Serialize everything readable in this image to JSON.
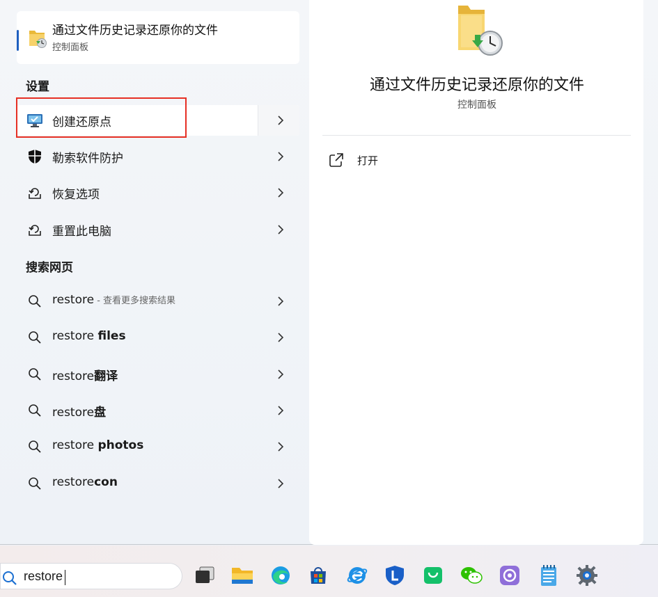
{
  "best_match": {
    "title": "通过文件历史记录还原你的文件",
    "subtitle": "控制面板"
  },
  "settings_section": {
    "header": "设置",
    "items": [
      {
        "label": "创建还原点",
        "icon": "system-restore-monitor-icon"
      },
      {
        "label": "勒索软件防护",
        "icon": "shield-icon"
      },
      {
        "label": "恢复选项",
        "icon": "recovery-icon"
      },
      {
        "label": "重置此电脑",
        "icon": "reset-pc-icon"
      }
    ]
  },
  "web_section": {
    "header": "搜索网页",
    "items": [
      {
        "prefix": "restore",
        "bold": "",
        "hint": " - 查看更多搜索结果"
      },
      {
        "prefix": "restore ",
        "bold": "files",
        "hint": ""
      },
      {
        "prefix": "restore",
        "bold": "翻译",
        "hint": ""
      },
      {
        "prefix": "restore",
        "bold": "盘",
        "hint": ""
      },
      {
        "prefix": "restore ",
        "bold": "photos",
        "hint": ""
      },
      {
        "prefix": "restore",
        "bold": "con",
        "hint": ""
      }
    ]
  },
  "preview": {
    "title": "通过文件历史记录还原你的文件",
    "subtitle": "控制面板",
    "open_label": "打开"
  },
  "taskbar": {
    "search_value": "restore",
    "apps": [
      {
        "name": "task-view-icon"
      },
      {
        "name": "file-explorer-icon"
      },
      {
        "name": "edge-icon"
      },
      {
        "name": "microsoft-store-icon"
      },
      {
        "name": "ie-browser-icon"
      },
      {
        "name": "lenovo-app-icon"
      },
      {
        "name": "shopping-bag-app-icon"
      },
      {
        "name": "wechat-icon"
      },
      {
        "name": "camera-app-icon"
      },
      {
        "name": "notepad-icon"
      },
      {
        "name": "settings-gear-icon"
      }
    ]
  },
  "colors": {
    "accent": "#1f5fbf",
    "highlight_box": "#e62f24"
  }
}
